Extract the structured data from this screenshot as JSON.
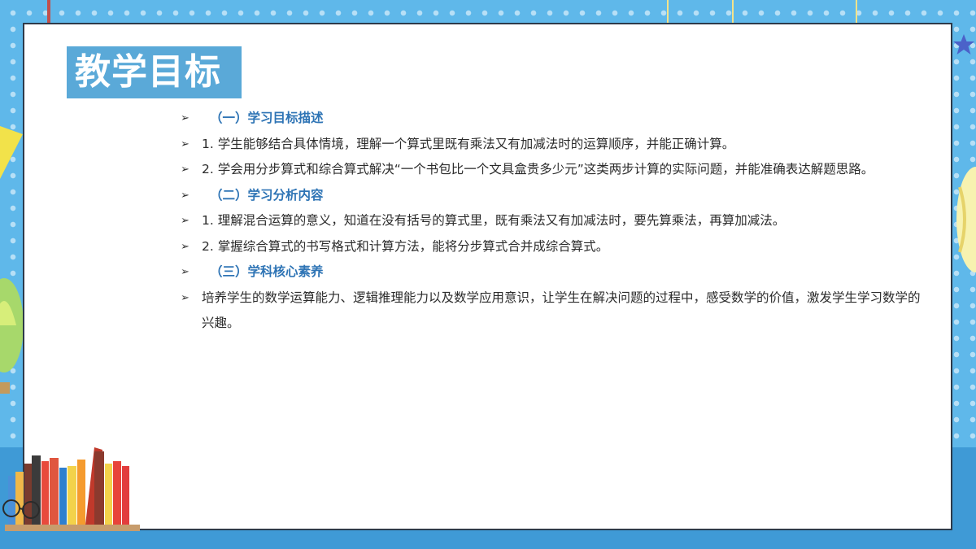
{
  "slide": {
    "title": "教学目标",
    "items": [
      {
        "kind": "heading",
        "text": "（一）学习目标描述"
      },
      {
        "kind": "body",
        "text": "1. 学生能够结合具体情境，理解一个算式里既有乘法又有加减法时的运算顺序，并能正确计算。"
      },
      {
        "kind": "body",
        "text": "2. 学会用分步算式和综合算式解决“一个书包比一个文具盒贵多少元”这类两步计算的实际问题，并能准确表达解题思路。"
      },
      {
        "kind": "heading",
        "text": "（二）学习分析内容"
      },
      {
        "kind": "body",
        "text": "1. 理解混合运算的意义，知道在没有括号的算式里，既有乘法又有加减法时，要先算乘法，再算加减法。"
      },
      {
        "kind": "body",
        "text": "2. 掌握综合算式的书写格式和计算方法，能将分步算式合并成综合算式。"
      },
      {
        "kind": "heading",
        "text": "（三）学科核心素养"
      },
      {
        "kind": "body",
        "text": "培养学生的数学运算能力、逻辑推理能力以及数学应用意识，让学生在解决问题的过程中，感受数学的价值，激发学生学习数学的兴趣。"
      }
    ]
  },
  "icons": {
    "bullet": "arrowhead-bullet-icon",
    "books": "books-illustration",
    "balloon": "hot-air-balloon-icon",
    "star": "star-icon",
    "glasses": "glasses-icon"
  },
  "colors": {
    "background": "#5fb8ea",
    "title_box": "#5aa9d8",
    "heading_text": "#2e74b5",
    "body_text": "#2b2b2b"
  }
}
